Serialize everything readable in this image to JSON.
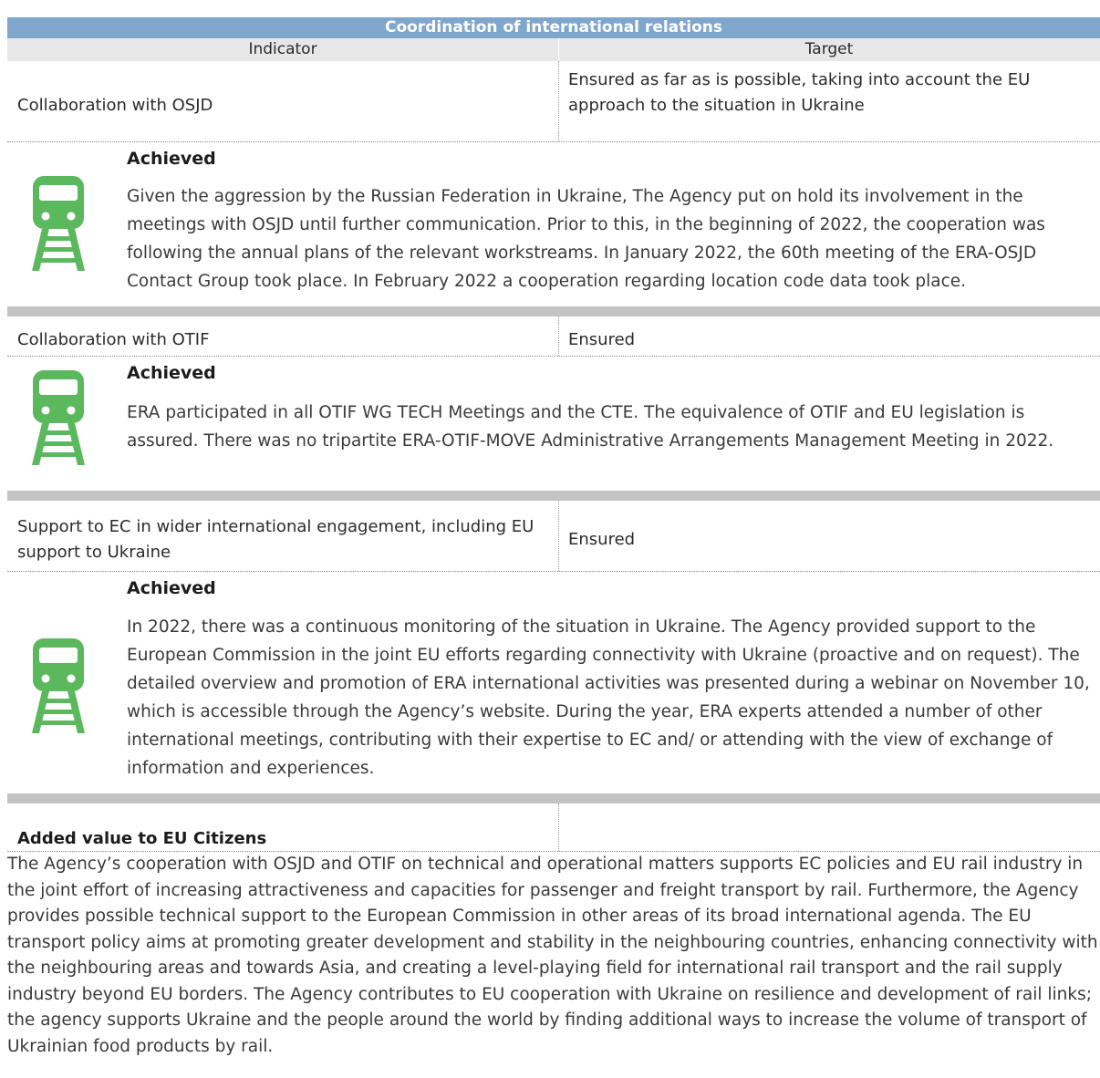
{
  "header": {
    "title": "Coordination of international relations",
    "col_indicator": "Indicator",
    "col_target": "Target"
  },
  "rows": [
    {
      "indicator": "Collaboration with OSJD",
      "target": "Ensured as far as is possible, taking into account the EU approach to the situation in Ukraine",
      "status": "Achieved",
      "icon": "train-icon",
      "description": "Given the aggression by the Russian Federation in Ukraine, The Agency put on hold its involvement in the meetings with OSJD until further communication. Prior to this, in the beginning of 2022, the cooperation was following the annual plans of the relevant workstreams. In January 2022, the 60th meeting of the ERA-OSJD Contact Group took place. In February 2022 a cooperation regarding location code data took place."
    },
    {
      "indicator": "Collaboration with OTIF",
      "target": "Ensured",
      "status": "Achieved",
      "icon": "train-icon",
      "description": "ERA participated in all OTIF WG TECH Meetings and the CTE. The equivalence of OTIF and EU legislation is assured. There was no tripartite ERA-OTIF-MOVE Administrative Arrangements Management Meeting in 2022."
    },
    {
      "indicator": "Support to EC in wider international engagement, including EU support to Ukraine",
      "target": "Ensured",
      "status": "Achieved",
      "icon": "train-icon",
      "description": "In 2022, there was a continuous monitoring of the situation in Ukraine. The Agency provided support to the European Commission in the joint EU efforts regarding connectivity with Ukraine (proactive and on request). The detailed overview and promotion of ERA international activities was presented during a webinar on November 10, which is accessible through the Agency’s website. During the year, ERA experts attended a number of other international meetings, contributing with their expertise to EC and/ or attending with the view of exchange of information and experiences."
    }
  ],
  "added_value": {
    "title": "Added value to EU Citizens",
    "text": "The Agency’s cooperation with OSJD and OTIF on technical and operational matters supports EC policies and EU rail industry in the joint effort of increasing attractiveness and capacities for passenger and freight transport by rail. Furthermore, the Agency provides possible technical support to the European Commission in other areas of its broad international agenda. The EU transport policy aims at promoting greater development and stability in the neighbouring countries, enhancing connectivity with the neighbouring areas and towards Asia, and creating a level-playing field for international rail transport and the rail supply industry beyond EU borders. The Agency contributes to EU cooperation with Ukraine on resilience and development of rail links; the agency supports Ukraine and the people around the world by finding additional ways to increase the volume of transport of Ukrainian food products by rail."
  },
  "colors": {
    "title_bar": "#7fa6cc",
    "header_row": "#e7e7e7",
    "band": "#c3c3c3",
    "icon_green": "#5cb85c"
  }
}
